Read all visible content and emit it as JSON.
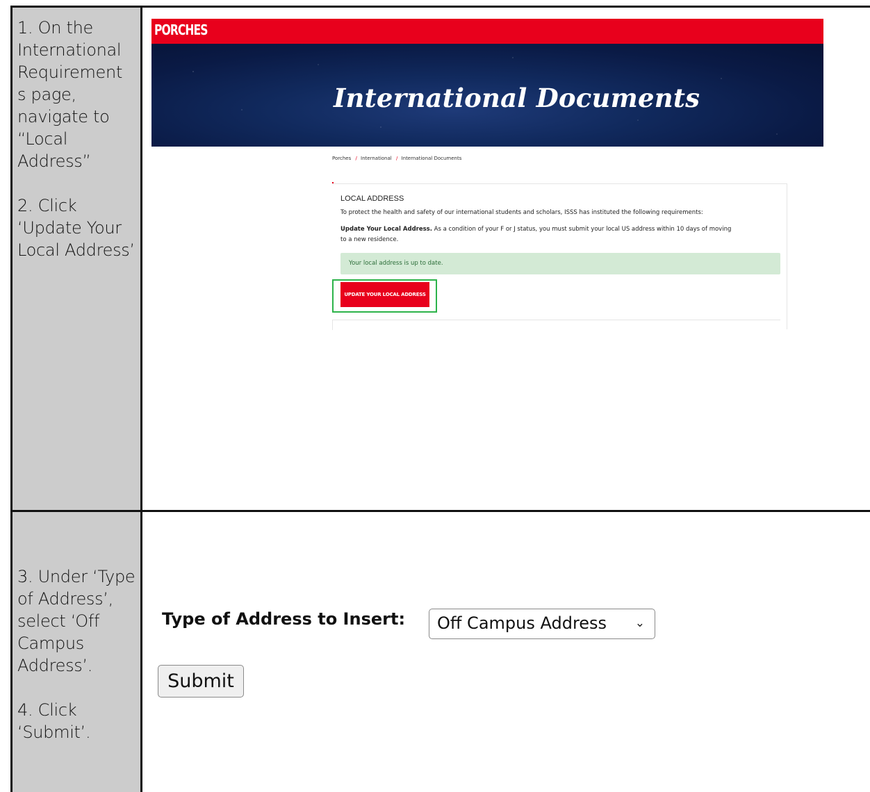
{
  "steps": {
    "row1": [
      "1. On the International Requirement s page, navigate to “Local Address”",
      "2. Click ‘Update Your Local Address’"
    ],
    "row2": [
      "3. Under ‘Type of Address’, select ‘Off Campus Address’.",
      "4. Click ‘Submit’."
    ]
  },
  "screenshot1": {
    "logo": "PORCHES",
    "hero_title": "International Documents",
    "breadcrumb": [
      "Porches",
      "International",
      "International Documents"
    ],
    "section_title": "LOCAL ADDRESS",
    "intro": "To protect the health and safety of our international students and scholars, ISSS has instituted the following requirements:",
    "update_bold": "Update Your Local Address.",
    "update_text_1": " As a condition of your F or J status, you must submit your local US address within 10 days of moving",
    "update_text_2": "to a new residence.",
    "status_message": "Your local address is up to date.",
    "button_label": "UPDATE YOUR LOCAL ADDRESS",
    "colors": {
      "brand_red": "#e8001c",
      "highlight_green": "#2db34a",
      "success_bg": "#d3ead5"
    }
  },
  "screenshot2": {
    "type_label": "Type of Address to Insert:",
    "selected_option": "Off Campus Address",
    "submit_label": "Submit"
  }
}
